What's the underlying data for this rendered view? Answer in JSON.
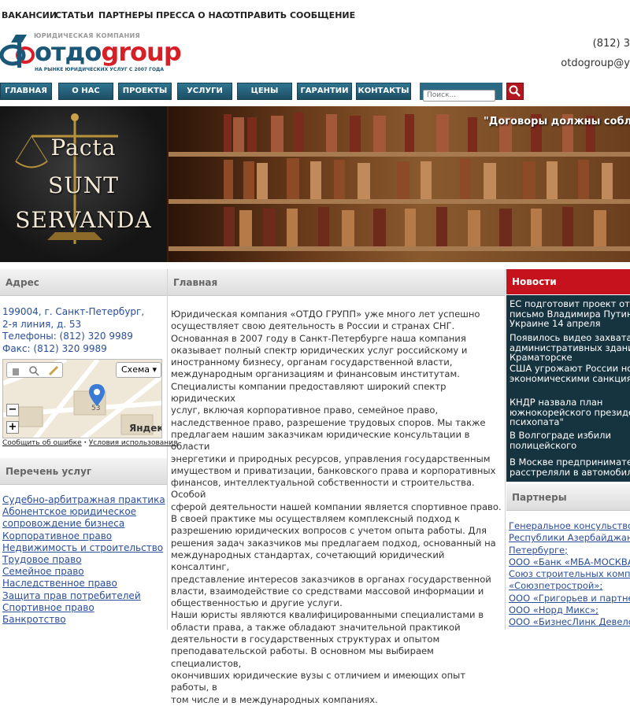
{
  "top_nav": [
    "ВАКАНСИИ",
    "СТАТЬИ",
    "ПАРТНЕРЫ",
    "ПРЕССА О НАС",
    "ОТПРАВИТЬ СООБЩЕНИЕ"
  ],
  "logo": {
    "tagline_top": "ЮРИДИЧЕСКАЯ КОМПАНИЯ",
    "word_a": "отдо",
    "word_b": "group",
    "tagline_bottom": "НА РЫНКЕ ЮРИДИЧЕСКИХ УСЛУГ С 2007 ГОДА"
  },
  "contact": {
    "phone": "(812) 3",
    "email": "otdogroup@y"
  },
  "main_nav": [
    "ГЛАВНАЯ",
    "О НАС",
    "ПРОЕКТЫ",
    "УСЛУГИ",
    "ЦЕНЫ",
    "ГАРАНТИИ",
    "КОНТАКТЫ"
  ],
  "search": {
    "placeholder": "Поиск..."
  },
  "banner": {
    "line1": "Pacta",
    "line2": "SUNT",
    "line3": "SERVANDA",
    "quote": "\"Договоры должны соблю"
  },
  "left": {
    "address_title": "Адрес",
    "address_lines": [
      "199004, г. Санкт-Петербург,",
      "2-я линия, д. 53",
      "Телефоны: (812) 320 9989",
      "Факс: (812) 320 9989"
    ],
    "map": {
      "scheme": "Схема",
      "brand": "Яндекс",
      "house": "53",
      "report": "Сообщить об ошибке",
      "terms": "Условия использования",
      "separator": "·"
    },
    "services_title": "Перечень услуг",
    "services": [
      "Судебно-арбитражная практика",
      "Абонентское юридическое",
      "сопровождение бизнеса",
      "Корпоративное право",
      "Недвижимость и строительство",
      "Трудовое право",
      "Семейное право",
      "Наследственное право",
      "Защита прав потребителей",
      "Спортивное право",
      "Банкротство"
    ]
  },
  "center": {
    "title": "Главная",
    "lines": [
      "Юридическая компания «ОТДО ГРУПП» уже много лет успешно",
      "осуществляет свою деятельность в России и странах СНГ.",
      "Основанная в 2007 году в Санкт-Петербурге наша компания",
      "оказывает полный спектр юридических услуг российскому и",
      "иностранному бизнесу, органам государственной власти,",
      "международным организациям и финансовым институтам.",
      "Специалисты компании предоставляют широкий спектр юридических",
      "услуг, включая корпоративное право, семейное право,",
      "наследственное право, разрешение трудовых споров. Мы также",
      "предлагаем нашим заказчикам юридические консультации в области",
      "энергетики и природных ресурсов, управления государственным",
      "имуществом и приватизации, банковского права и корпоративных",
      "финансов, интеллектуальной собственности и строительства. Особой",
      "сферой деятельности нашей компании является спортивное право.",
      "В своей практике мы осуществляем комплексный подход к",
      "разрешению юридических вопросов с учетом опыта работы. Для",
      "решения задач заказчиков мы предлагаем подход, основанный на",
      "международных стандартах, сочетающий юридический консалтинг,",
      "представление интересов заказчиков в органах государственной",
      "власти, взаимодействие со средствами массовой информации и",
      "общественностью и другие услуги.",
      "Наши юристы являются квалифицированными специалистами в",
      "области права, а также обладают значительной практикой",
      "деятельности в государственных структурах и опытом",
      "преподавательской работы. В основном мы выбираем специалистов,",
      "окончивших юридические вузы с отличием и имеющих опыт работы, в",
      "том числе и в международных компаниях."
    ]
  },
  "right": {
    "news_title": "Новости",
    "news": [
      [
        "ЕС подготовит проект отв",
        "письмо Владимира Путина",
        "Украине 14 апреля"
      ],
      [
        "Появилось видео захвата",
        "административных зданий",
        "Краматорске"
      ],
      [
        "США угрожают России нов",
        "экономическими санкциям"
      ],
      [
        "КНДР назвала план",
        "южнокорейского президе",
        "психопата\""
      ],
      [
        "В Волгограде избили",
        "полицейского"
      ],
      [
        "В Москве предпринимател",
        "расстреляли в автомобиле"
      ]
    ],
    "partners_title": "Партнеры",
    "partners": [
      "Генеральное консульство",
      "Республики Азербайджан",
      "Петербурге;",
      "ООО «Банк «МБА-МОСКВА",
      "Союз строительных компан",
      "«Союзпетрострой»;",
      "ООО «Григорьев и партне",
      "ООО «Норд Микс»;",
      "ООО «БизнесЛинк Девело"
    ]
  },
  "colors": {
    "brand_blue": "#1b5877",
    "brand_red": "#d61f26",
    "nav_blue": "#235f77",
    "news_bg": "#163340",
    "news_header": "#c6121c",
    "link": "#2a4e9a"
  }
}
